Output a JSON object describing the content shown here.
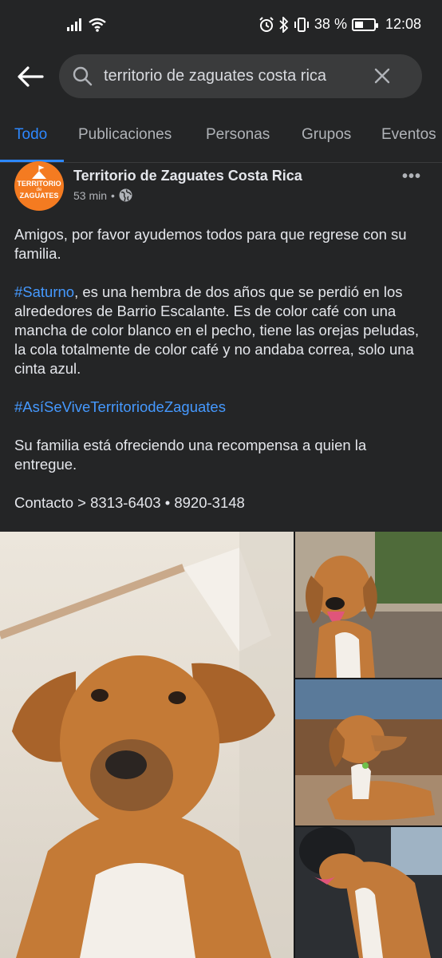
{
  "status_bar": {
    "battery": "38 %",
    "time": "12:08"
  },
  "search": {
    "query": "territorio de zaguates costa rica"
  },
  "tabs": [
    {
      "label": "Todo",
      "active": true
    },
    {
      "label": "Publicaciones"
    },
    {
      "label": "Personas"
    },
    {
      "label": "Grupos"
    },
    {
      "label": "Eventos"
    }
  ],
  "post": {
    "page_name": "Territorio de Zaguates Costa Rica",
    "time": "53 min",
    "separator": "•",
    "audience_icon": "globe-icon",
    "avatar_logo": {
      "line1": "TERRITORIO",
      "line2": "de",
      "line3": "ZAGUATES"
    },
    "para1": "Amigos, por favor ayudemos todos para que regrese con su familia.",
    "para2_tag": "#Saturno",
    "para2_rest": ", es una hembra de dos años que se perdió en los alrededores de Barrio Escalante. Es de color café con una mancha de color blanco en el pecho, tiene las orejas peludas, la cola totalmente de color café y no andaba correa, solo una cinta azul.",
    "para3_tag": "#AsíSeViveTerritoriodeZaguates",
    "para4": "Su familia está ofreciendo una recompensa a quien la entregue.",
    "para5": "Contacto > 8313-6403 • 8920-3148"
  },
  "colors": {
    "accent": "#2d88ff",
    "hashtag": "#4599ff",
    "background": "#242526",
    "logo_orange": "#f47b21"
  }
}
